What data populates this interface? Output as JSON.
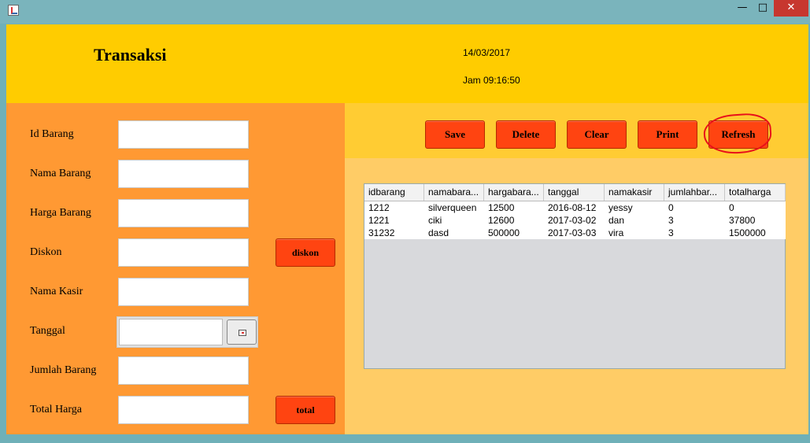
{
  "window": {
    "minimize_glyph": "—",
    "maximize_glyph": "□",
    "close_glyph": "✕"
  },
  "header": {
    "title": "Transaksi",
    "date": "14/03/2017",
    "time": "Jam 09:16:50"
  },
  "form": {
    "labels": [
      "Id Barang",
      "Nama Barang",
      "Harga Barang",
      "Diskon",
      "Nama Kasir",
      "Tanggal",
      "Jumlah Barang",
      "Total Harga"
    ],
    "diskon_button": "diskon",
    "total_button": "total"
  },
  "toolbar": {
    "save": "Save",
    "delete": "Delete",
    "clear": "Clear",
    "print": "Print",
    "refresh": "Refresh"
  },
  "table": {
    "headers": [
      "idbarang",
      "namabara...",
      "hargabara...",
      "tanggal",
      "namakasir",
      "jumlahbar...",
      "totalharga"
    ],
    "rows": [
      [
        "1212",
        "silverqueen",
        "12500",
        "2016-08-12",
        "yessy",
        "0",
        "0"
      ],
      [
        "1221",
        "ciki",
        "12600",
        "2017-03-02",
        "dan",
        "3",
        "37800"
      ],
      [
        "31232",
        "dasd",
        "500000",
        "2017-03-03",
        "vira",
        "3",
        "1500000"
      ]
    ]
  },
  "colors": {
    "header_bg": "#ffcc00",
    "left_panel_bg": "#ff9933",
    "button_bg": "#ff4411",
    "highlight": "#e8101a"
  }
}
